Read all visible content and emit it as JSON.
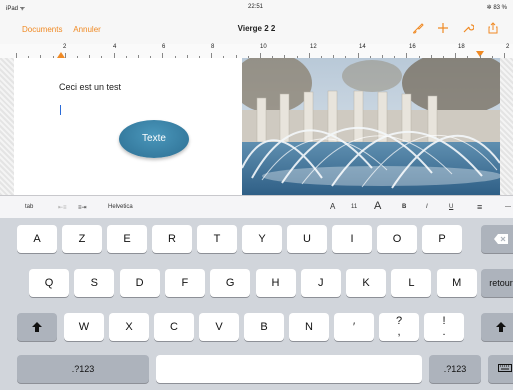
{
  "status_bar": {
    "left": "iPad ᯤ",
    "time": "22:51",
    "right": "✲ 83 %"
  },
  "nav": {
    "documents": "Documents",
    "cancel": "Annuler",
    "title": "Vierge 2 2",
    "accent_color": "#f08a24",
    "icons": [
      "brush-icon",
      "plus-icon",
      "wrench-icon",
      "share-icon"
    ]
  },
  "ruler": {
    "numbers": [
      "2",
      "4",
      "6",
      "8",
      "10",
      "12",
      "14",
      "16",
      "18",
      "2"
    ]
  },
  "document": {
    "body_text": "Ceci est un test",
    "shape_label": "Texte"
  },
  "toolbar": {
    "tab": "tab",
    "indent_left": "⇤≡",
    "indent_right": "≡⇥",
    "font": "Helvetica",
    "size_small": "A",
    "size": "11",
    "size_large": "A",
    "bold": "B",
    "italic": "I",
    "underline": "U",
    "align": "≡",
    "more": "—"
  },
  "keyboard": {
    "row1": [
      "A",
      "Z",
      "E",
      "R",
      "T",
      "Y",
      "U",
      "I",
      "O",
      "P"
    ],
    "row2": [
      "Q",
      "S",
      "D",
      "F",
      "G",
      "H",
      "J",
      "K",
      "L",
      "M"
    ],
    "row3": [
      "W",
      "X",
      "C",
      "V",
      "B",
      "N",
      "′",
      "?\n,",
      "!\n."
    ],
    "return": "retour",
    "numbers_left": ".?123",
    "numbers_right": ".?123"
  }
}
